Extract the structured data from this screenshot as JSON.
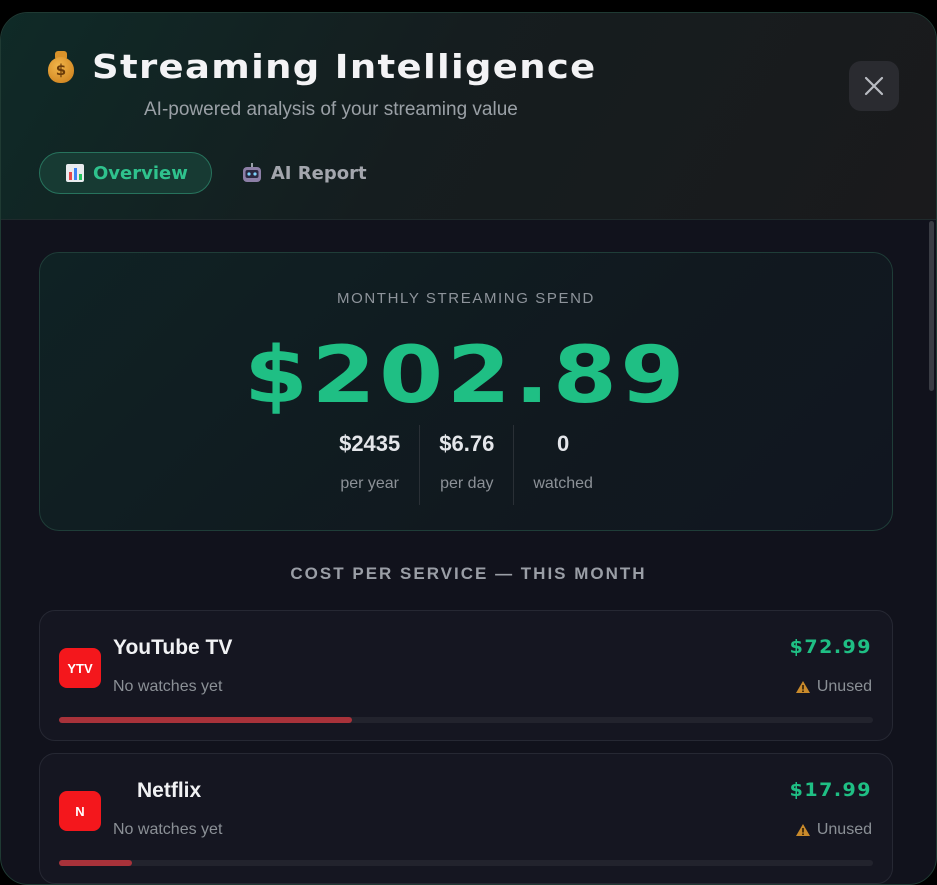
{
  "header": {
    "title": "Streaming Intelligence",
    "subtitle": "AI-powered analysis of your streaming value",
    "tabs": [
      {
        "label": "Overview",
        "icon": "bar-chart-icon",
        "active": true
      },
      {
        "label": "AI Report",
        "icon": "robot-icon",
        "active": false
      }
    ]
  },
  "spend": {
    "label": "MONTHLY STREAMING SPEND",
    "amount": "$202.89",
    "stats": [
      {
        "value": "$2435",
        "label": "per year"
      },
      {
        "value": "$6.76",
        "label": "per day"
      },
      {
        "value": "0",
        "label": "watched"
      }
    ]
  },
  "services_section": {
    "title": "COST PER SERVICE — THIS MONTH",
    "items": [
      {
        "logo_text": "YTV",
        "name": "YouTube TV",
        "sub": "No watches yet",
        "price": "$72.99",
        "status": "Unused",
        "share": 0.36
      },
      {
        "logo_text": "N",
        "name": "Netflix",
        "sub": "No watches yet",
        "price": "$17.99",
        "status": "Unused",
        "share": 0.09
      }
    ]
  },
  "colors": {
    "accent": "#1fbf84",
    "danger_bar": "#a8323a",
    "logo_red": "#f4171c"
  }
}
